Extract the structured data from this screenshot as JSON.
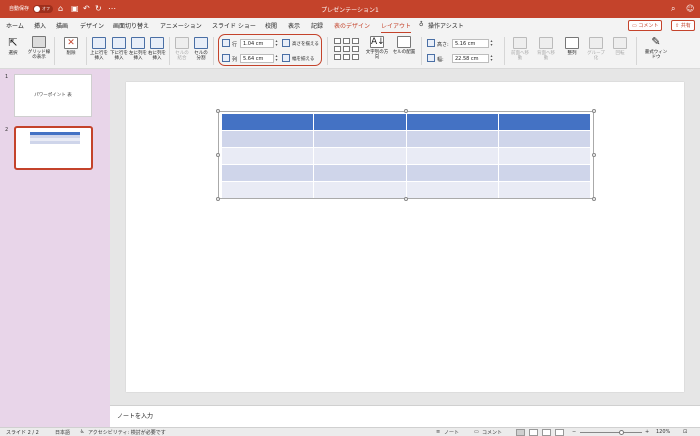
{
  "titlebar": {
    "autosave": "自動保存",
    "toggle": "オフ",
    "title": "プレゼンテーション1"
  },
  "tabs": [
    {
      "label": "ホーム"
    },
    {
      "label": "挿入"
    },
    {
      "label": "描画"
    },
    {
      "label": "デザイン"
    },
    {
      "label": "画面切り替え"
    },
    {
      "label": "アニメーション"
    },
    {
      "label": "スライド ショー"
    },
    {
      "label": "校閲"
    },
    {
      "label": "表示"
    },
    {
      "label": "記録"
    },
    {
      "label": "表のデザイン"
    },
    {
      "label": "レイアウト"
    },
    {
      "label": "操作アシスト"
    }
  ],
  "header_buttons": {
    "comment": "コメント",
    "share": "共有"
  },
  "ribbon": {
    "select": "選択",
    "gridlines": "グリッド線の表示",
    "delete": "削除",
    "insert_above": "上に行を挿入",
    "insert_below": "下に行を挿入",
    "insert_left": "左に列を挿入",
    "insert_right": "右に列を挿入",
    "merge": "セルの結合",
    "split": "セルの分割",
    "row_label": "行",
    "row_height": "1.04 cm",
    "col_label": "列",
    "col_width": "5.64 cm",
    "distribute_rows": "高さを揃える",
    "distribute_cols": "幅を揃える",
    "text_direction": "文字列の方向",
    "cell_margins": "セルの配置",
    "height_label": "高さ:",
    "height_value": "5.16 cm",
    "width_label": "幅:",
    "width_value": "22.58 cm",
    "bring_forward": "前面へ移動",
    "send_backward": "背面へ移動",
    "align": "整列",
    "group": "グループ化",
    "rotate": "回転",
    "format_pane": "書式ウィンドウ"
  },
  "slides": [
    {
      "number": "1",
      "text": "パワーポイント 表"
    },
    {
      "number": "2",
      "text": ""
    }
  ],
  "notes_placeholder": "ノートを入力",
  "status": {
    "slide": "スライド 2 / 2",
    "language": "日本語",
    "accessibility": "アクセシビリティ: 検討が必要です",
    "notes": "ノート",
    "comments": "コメント",
    "zoom": "120%"
  },
  "colors": {
    "accent": "#c4432b",
    "table_header": "#4472c4",
    "table_band": "#cfd5ea",
    "table_row": "#e9ebf5",
    "pane": "#e8d5e9"
  },
  "table": {
    "rows": 5,
    "cols": 4
  }
}
